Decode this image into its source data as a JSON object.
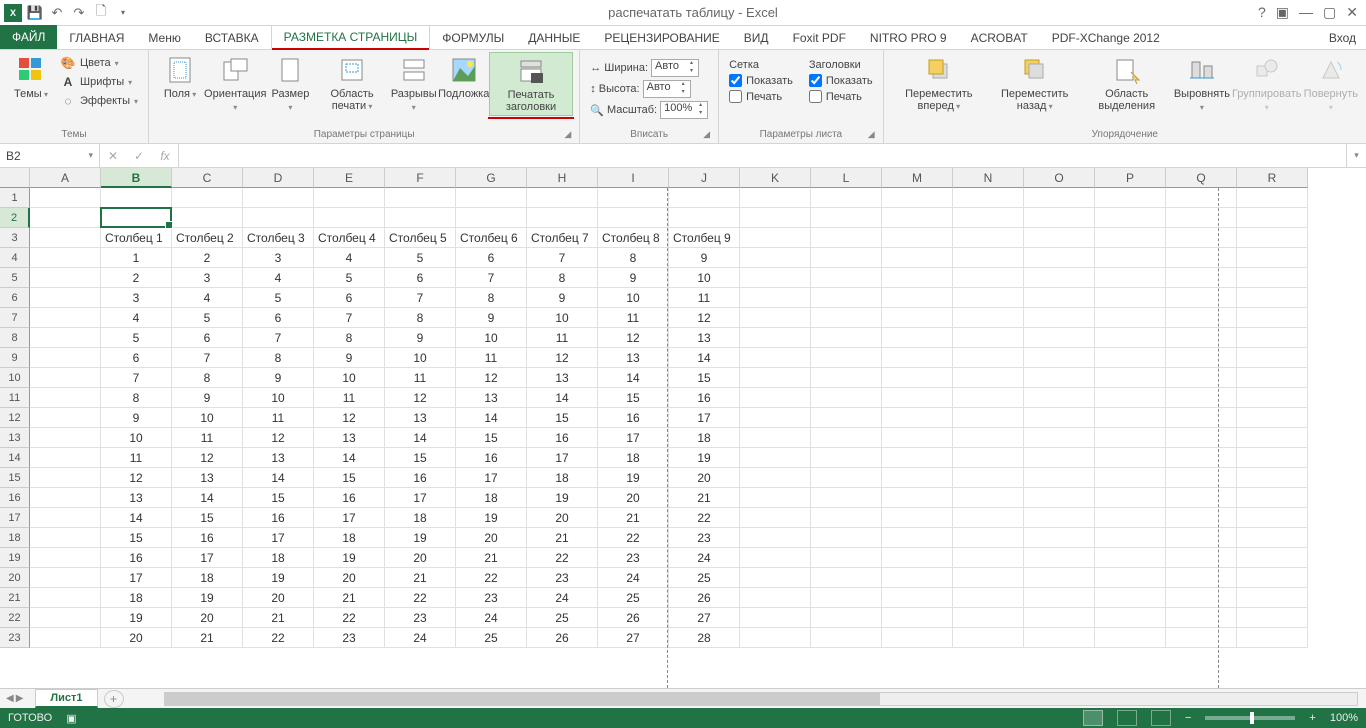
{
  "title": "распечатать таблицу - Excel",
  "signin": "Вход",
  "tabs": {
    "file": "ФАЙЛ",
    "home": "ГЛАВНАЯ",
    "menu": "Меню",
    "insert": "ВСТАВКА",
    "pagelayout": "РАЗМЕТКА СТРАНИЦЫ",
    "formulas": "ФОРМУЛЫ",
    "data": "ДАННЫЕ",
    "review": "РЕЦЕНЗИРОВАНИЕ",
    "view": "ВИД",
    "foxit": "Foxit PDF",
    "nitro": "NITRO PRO 9",
    "acrobat": "ACROBAT",
    "pdfx": "PDF-XChange 2012"
  },
  "ribbon": {
    "themes": {
      "themes": "Темы",
      "colors": "Цвета",
      "fonts": "Шрифты",
      "effects": "Эффекты",
      "label": "Темы"
    },
    "pagesetup": {
      "margins": "Поля",
      "orientation": "Ориентация",
      "size": "Размер",
      "printarea": "Область печати",
      "breaks": "Разрывы",
      "background": "Подложка",
      "printtitles": "Печатать заголовки",
      "label": "Параметры страницы"
    },
    "scale": {
      "width_lbl": "Ширина:",
      "width_val": "Авто",
      "height_lbl": "Высота:",
      "height_val": "Авто",
      "scale_lbl": "Масштаб:",
      "scale_val": "100%",
      "label": "Вписать"
    },
    "sheetopts": {
      "gridlines": "Сетка",
      "headings": "Заголовки",
      "view": "Показать",
      "print": "Печать",
      "label": "Параметры листа"
    },
    "arrange": {
      "front": "Переместить вперед",
      "back": "Переместить назад",
      "selpane": "Область выделения",
      "align": "Выровнять",
      "group": "Группировать",
      "rotate": "Повернуть",
      "label": "Упорядочение"
    }
  },
  "namebox": "B2",
  "columns": [
    "A",
    "B",
    "C",
    "D",
    "E",
    "F",
    "G",
    "H",
    "I",
    "J",
    "K",
    "L",
    "M",
    "N",
    "O",
    "P",
    "Q",
    "R"
  ],
  "col_headers": [
    "Столбец 1",
    "Столбец 2",
    "Столбец 3",
    "Столбец 4",
    "Столбец 5",
    "Столбец 6",
    "Столбец 7",
    "Столбец 8",
    "Столбец 9"
  ],
  "data_rows": [
    [
      1,
      2,
      3,
      4,
      5,
      6,
      7,
      8,
      9
    ],
    [
      2,
      3,
      4,
      5,
      6,
      7,
      8,
      9,
      10
    ],
    [
      3,
      4,
      5,
      6,
      7,
      8,
      9,
      10,
      11
    ],
    [
      4,
      5,
      6,
      7,
      8,
      9,
      10,
      11,
      12
    ],
    [
      5,
      6,
      7,
      8,
      9,
      10,
      11,
      12,
      13
    ],
    [
      6,
      7,
      8,
      9,
      10,
      11,
      12,
      13,
      14
    ],
    [
      7,
      8,
      9,
      10,
      11,
      12,
      13,
      14,
      15
    ],
    [
      8,
      9,
      10,
      11,
      12,
      13,
      14,
      15,
      16
    ],
    [
      9,
      10,
      11,
      12,
      13,
      14,
      15,
      16,
      17
    ],
    [
      10,
      11,
      12,
      13,
      14,
      15,
      16,
      17,
      18
    ],
    [
      11,
      12,
      13,
      14,
      15,
      16,
      17,
      18,
      19
    ],
    [
      12,
      13,
      14,
      15,
      16,
      17,
      18,
      19,
      20
    ],
    [
      13,
      14,
      15,
      16,
      17,
      18,
      19,
      20,
      21
    ],
    [
      14,
      15,
      16,
      17,
      18,
      19,
      20,
      21,
      22
    ],
    [
      15,
      16,
      17,
      18,
      19,
      20,
      21,
      22,
      23
    ],
    [
      16,
      17,
      18,
      19,
      20,
      21,
      22,
      23,
      24
    ],
    [
      17,
      18,
      19,
      20,
      21,
      22,
      23,
      24,
      25
    ],
    [
      18,
      19,
      20,
      21,
      22,
      23,
      24,
      25,
      26
    ],
    [
      19,
      20,
      21,
      22,
      23,
      24,
      25,
      26,
      27
    ],
    [
      20,
      21,
      22,
      23,
      24,
      25,
      26,
      27,
      28
    ]
  ],
  "sheet_tab": "Лист1",
  "status_ready": "ГОТОВО",
  "zoom": "100%"
}
